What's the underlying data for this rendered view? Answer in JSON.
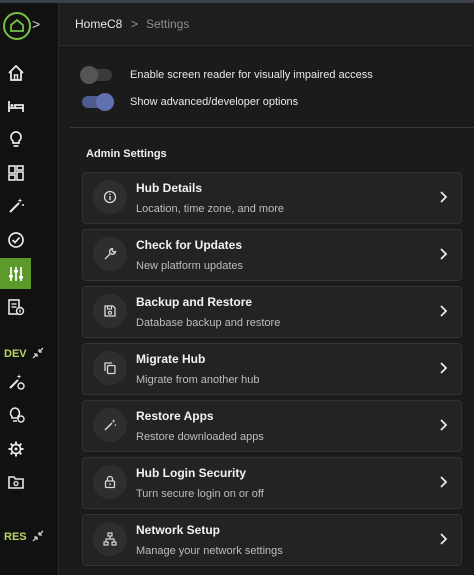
{
  "header": {
    "breadcrumb_home": "HomeC8",
    "breadcrumb_separator": ">",
    "breadcrumb_current": "Settings"
  },
  "toggles": [
    {
      "label": "Enable screen reader for visually impaired access",
      "state": "off"
    },
    {
      "label": "Show advanced/developer options",
      "state": "on"
    }
  ],
  "section_title": "Admin Settings",
  "cards": [
    {
      "title": "Hub Details",
      "subtitle": "Location, time zone, and more",
      "icon": "info-icon"
    },
    {
      "title": "Check for Updates",
      "subtitle": "New platform updates",
      "icon": "wrench-icon"
    },
    {
      "title": "Backup and Restore",
      "subtitle": "Database backup and restore",
      "icon": "save-icon"
    },
    {
      "title": "Migrate Hub",
      "subtitle": "Migrate from another hub",
      "icon": "copy-icon"
    },
    {
      "title": "Restore Apps",
      "subtitle": "Restore downloaded apps",
      "icon": "wand-icon"
    },
    {
      "title": "Hub Login Security",
      "subtitle": "Turn secure login on or off",
      "icon": "lock-icon"
    },
    {
      "title": "Network Setup",
      "subtitle": "Manage your network settings",
      "icon": "network-icon"
    }
  ],
  "sidebar": {
    "expand_glyph": ">",
    "dev_label": "DEV",
    "res_label": "RES",
    "icons": [
      "home-icon",
      "bed-icon",
      "bulb-icon",
      "dashboard-icon",
      "magic-wand-icon",
      "check-circle-icon",
      "settings-sliders-icon",
      "logs-icon",
      "apps-code-icon",
      "integrations-icon",
      "gear-icon",
      "file-manager-icon"
    ]
  },
  "colors": {
    "accent": "#76c043",
    "active": "#5c9a2b",
    "toggle_on": "#6170b0",
    "background": "#1b1b1b",
    "card": "#232323"
  }
}
